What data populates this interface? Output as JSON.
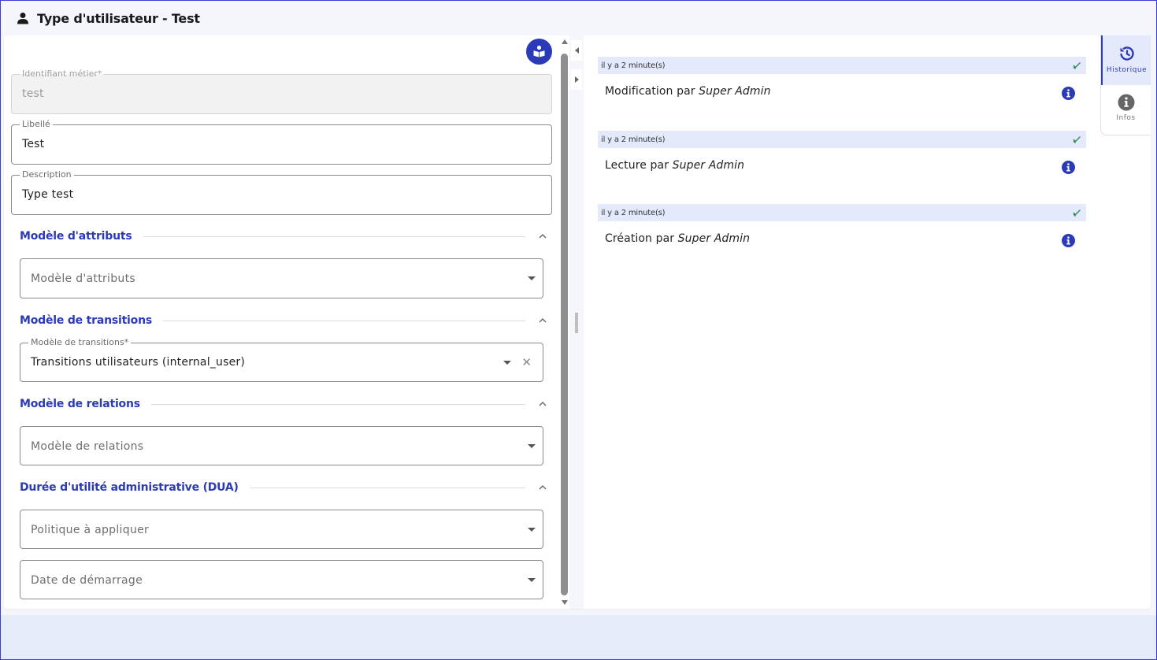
{
  "header": {
    "title": "Type d'utilisateur - Test",
    "icon": "user-icon"
  },
  "colors": {
    "accent": "#2b3bb8",
    "history_bar": "#e4e9fb",
    "check": "#2e8b57"
  },
  "form": {
    "identifiant": {
      "label": "Identifiant métier*",
      "value": "test",
      "disabled": true
    },
    "libelle": {
      "label": "Libellé",
      "value": "Test"
    },
    "description": {
      "label": "Description",
      "value": "Type test"
    },
    "sections": {
      "attributs": {
        "title": "Modèle d'attributs",
        "select": {
          "placeholder": "Modèle d'attributs"
        }
      },
      "transitions": {
        "title": "Modèle de transitions",
        "select": {
          "label": "Modèle de transitions*",
          "value": "Transitions utilisateurs (internal_user)",
          "clear": "✕"
        }
      },
      "relations": {
        "title": "Modèle de relations",
        "select": {
          "placeholder": "Modèle de relations"
        }
      },
      "dua": {
        "title": "Durée d'utilité administrative (DUA)",
        "politique": {
          "placeholder": "Politique à appliquer"
        },
        "date": {
          "placeholder": "Date de démarrage"
        }
      }
    }
  },
  "history": {
    "items": [
      {
        "time": "il y a 2 minute(s)",
        "action": "Modification par",
        "user": "Super Admin"
      },
      {
        "time": "il y a 2 minute(s)",
        "action": "Lecture par",
        "user": "Super Admin"
      },
      {
        "time": "il y a 2 minute(s)",
        "action": "Création par",
        "user": "Super Admin"
      }
    ]
  },
  "side_tabs": {
    "historique": "Historique",
    "infos": "Infos"
  }
}
